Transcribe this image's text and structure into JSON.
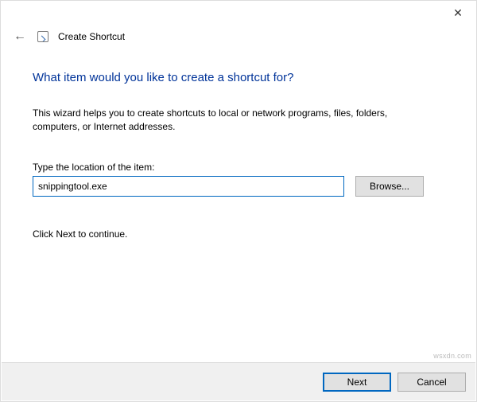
{
  "titlebar": {
    "close_glyph": "✕"
  },
  "header": {
    "back_glyph": "←",
    "title": "Create Shortcut"
  },
  "content": {
    "heading": "What item would you like to create a shortcut for?",
    "explain": "This wizard helps you to create shortcuts to local or network programs, files, folders, computers, or Internet addresses.",
    "field_label": "Type the location of the item:",
    "location_value": "snippingtool.exe",
    "browse_label": "Browse...",
    "continue_text": "Click Next to continue."
  },
  "footer": {
    "next_label": "Next",
    "cancel_label": "Cancel"
  },
  "watermark": "wsxdn.com"
}
